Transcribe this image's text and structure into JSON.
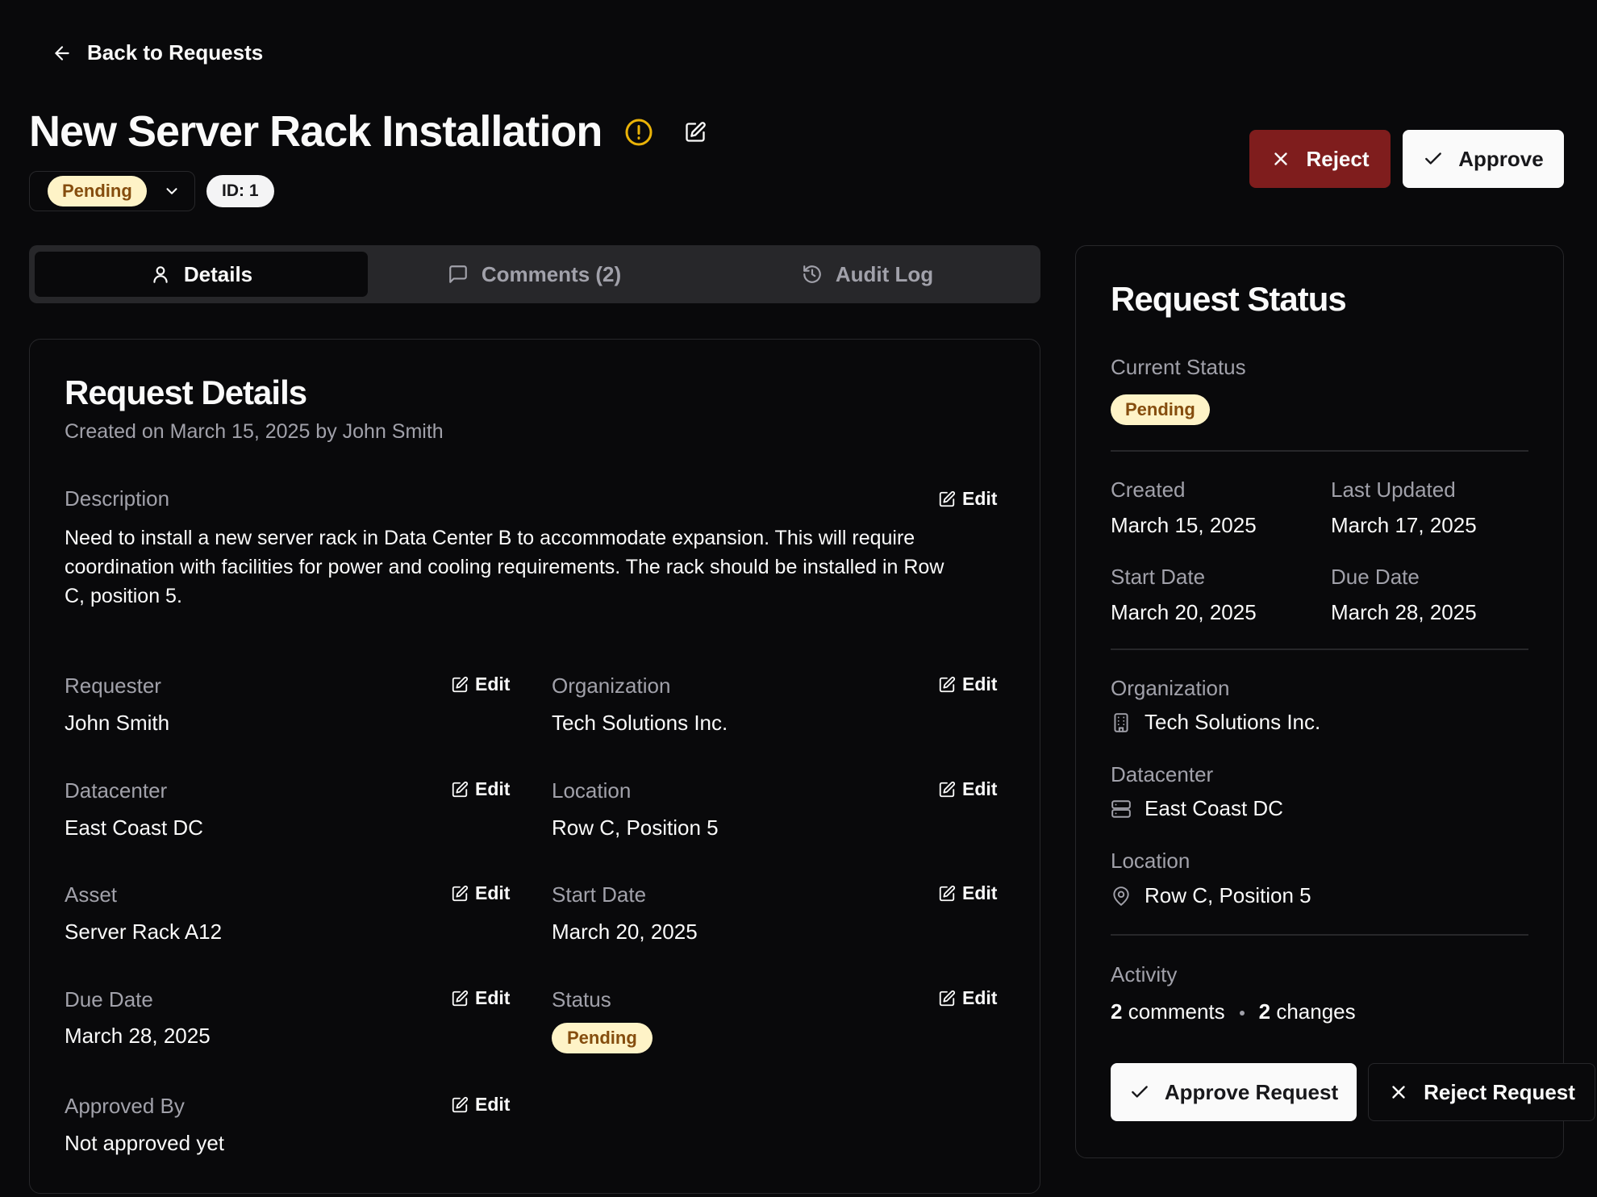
{
  "back_label": "Back to Requests",
  "title": "New Server Rack Installation",
  "status_select": {
    "value": "Pending"
  },
  "id_badge": "ID: 1",
  "actions": {
    "reject": "Reject",
    "approve": "Approve"
  },
  "tabs": [
    {
      "label": "Details",
      "icon": "user-icon",
      "active": true
    },
    {
      "label": "Comments (2)",
      "icon": "message-square-icon",
      "active": false
    },
    {
      "label": "Audit Log",
      "icon": "history-icon",
      "active": false
    }
  ],
  "details": {
    "title": "Request Details",
    "subtitle": "Created on March 15, 2025 by John Smith",
    "edit_label": "Edit",
    "description_label": "Description",
    "description_lines": [
      "Need to install a new server rack in Data Center B to accommodate expansion. This will require",
      "coordination with facilities for power and cooling requirements. The rack should be installed in Row",
      "C, position 5."
    ],
    "fields": {
      "requester": {
        "label": "Requester",
        "value": "John Smith"
      },
      "organization": {
        "label": "Organization",
        "value": "Tech Solutions Inc."
      },
      "datacenter": {
        "label": "Datacenter",
        "value": "East Coast DC"
      },
      "location": {
        "label": "Location",
        "value": "Row C, Position 5"
      },
      "asset": {
        "label": "Asset",
        "value": "Server Rack A12"
      },
      "start_date": {
        "label": "Start Date",
        "value": "March 20, 2025"
      },
      "due_date": {
        "label": "Due Date",
        "value": "March 28, 2025"
      },
      "status": {
        "label": "Status",
        "value": "Pending"
      },
      "approved_by": {
        "label": "Approved By",
        "value": "Not approved yet"
      }
    }
  },
  "status_card": {
    "title": "Request Status",
    "current_status_label": "Current Status",
    "current_status": "Pending",
    "created_label": "Created",
    "created": "March 15, 2025",
    "last_updated_label": "Last Updated",
    "last_updated": "March 17, 2025",
    "start_date_label": "Start Date",
    "start_date": "March 20, 2025",
    "due_date_label": "Due Date",
    "due_date": "March 28, 2025",
    "organization_label": "Organization",
    "organization": "Tech Solutions Inc.",
    "datacenter_label": "Datacenter",
    "datacenter": "East Coast DC",
    "location_label": "Location",
    "location": "Row C, Position 5",
    "activity_label": "Activity",
    "comments_count": "2",
    "comments_word": "comments",
    "changes_count": "2",
    "changes_word": "changes",
    "approve_button": "Approve Request",
    "reject_button": "Reject Request"
  },
  "colors": {
    "background": "#09090b",
    "border": "#27272a",
    "pending_bg": "#fef3c7",
    "pending_text": "#854d0e",
    "reject_bg": "#7f1d1d",
    "warning": "#eab308"
  }
}
